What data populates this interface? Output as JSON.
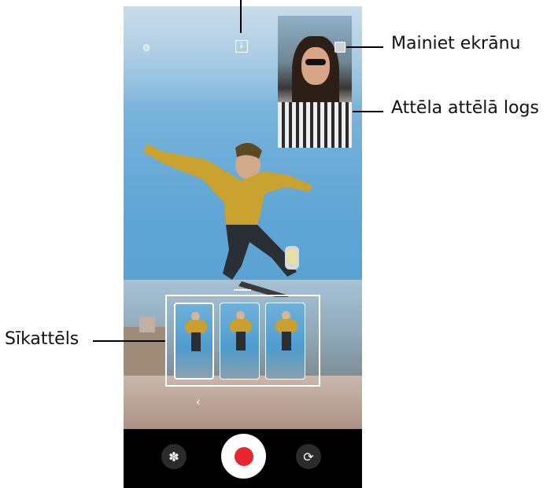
{
  "callouts": {
    "switch_screen": "Mainiet ekrānu",
    "pip_window": "Attēla attēlā logs",
    "thumbnail": "Sīkattēls"
  },
  "camera": {
    "settings_icon": "gear-icon",
    "save_icon": "download-icon",
    "swap_icon": "swap-screen-icon",
    "back_icon": "chevron-left-icon",
    "effects_icon": "effects-icon",
    "record_icon": "record-icon",
    "switch_camera_icon": "switch-camera-icon",
    "back_glyph": "‹",
    "settings_glyph": "⚙",
    "save_glyph": "↓",
    "effects_glyph": "✽",
    "switch_glyph": "⟳"
  },
  "colors": {
    "record": "#e8262c",
    "control_bar": "#000000"
  }
}
